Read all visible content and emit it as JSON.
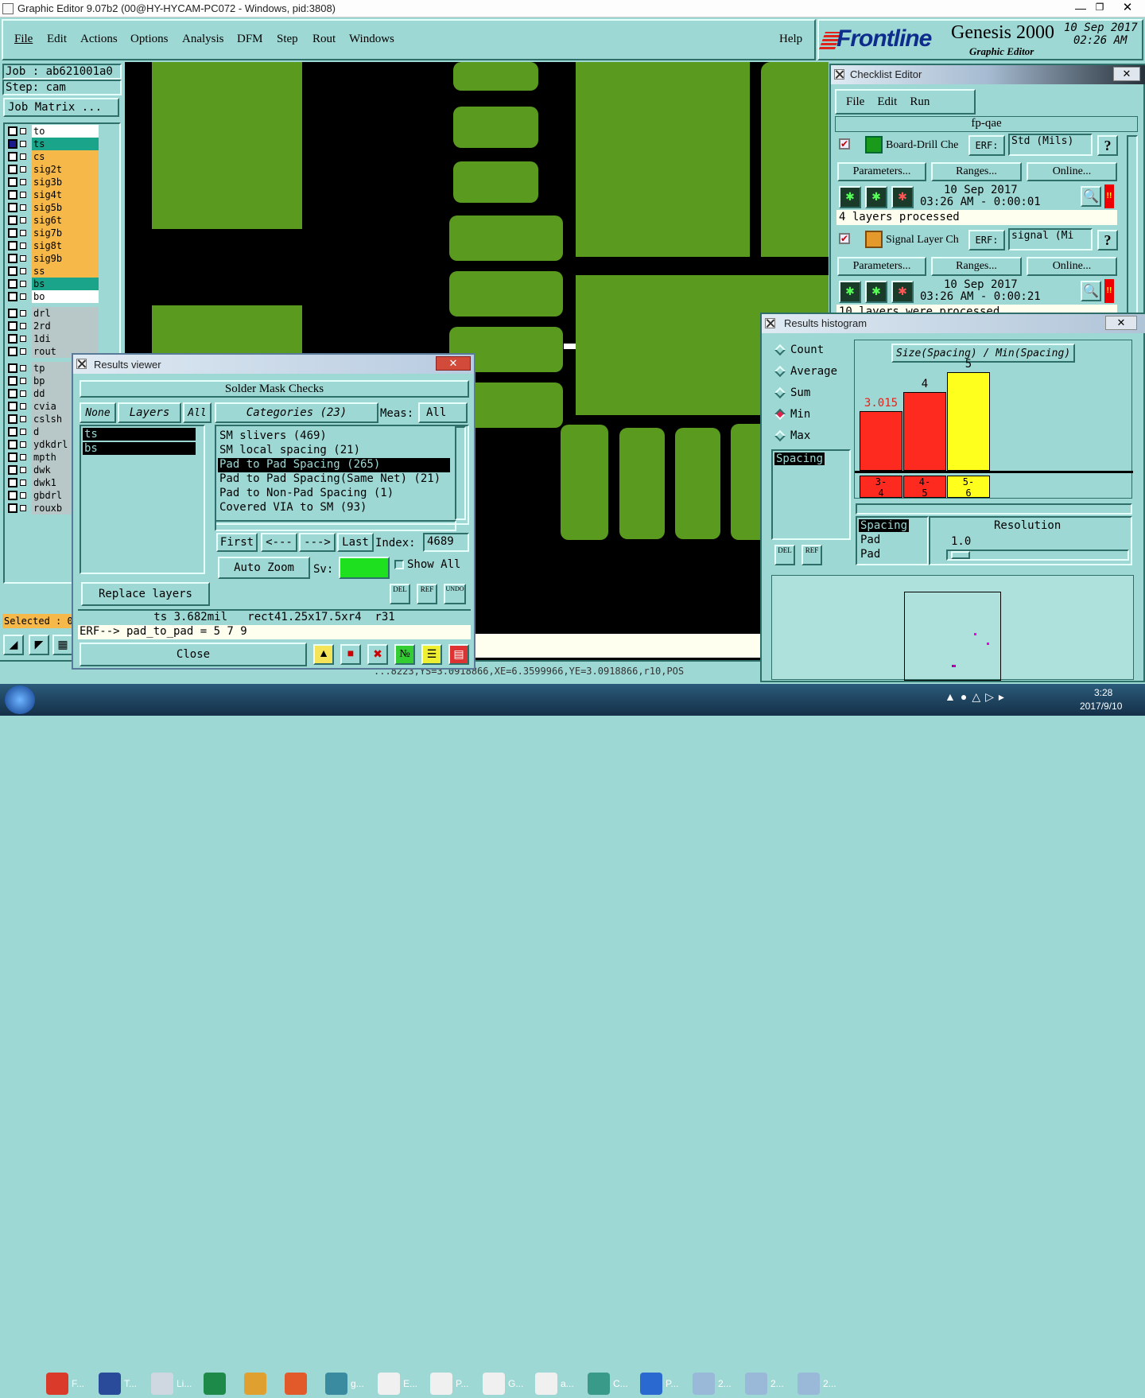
{
  "titlebar": {
    "title": "Graphic Editor 9.07b2 (00@HY-HYCAM-PC072 - Windows, pid:3808)"
  },
  "menu": {
    "items": [
      "File",
      "Edit",
      "Actions",
      "Options",
      "Analysis",
      "DFM",
      "Step",
      "Rout",
      "Windows"
    ],
    "help": "Help"
  },
  "brand": {
    "logo": "Frontline",
    "product": "Genesis 2000",
    "sub": "Graphic Editor",
    "date": "10 Sep 2017",
    "time": "02:26 AM"
  },
  "job": {
    "job": "Job : ab621001a0",
    "step": "Step: cam",
    "matrix": "Job Matrix ..."
  },
  "layers": [
    {
      "name": "to",
      "color": "#ffffff"
    },
    {
      "name": "ts",
      "color": "#1aa58a"
    },
    {
      "name": "cs",
      "color": "#f7b84a"
    },
    {
      "name": "sig2t",
      "color": "#f7b84a"
    },
    {
      "name": "sig3b",
      "color": "#f7b84a"
    },
    {
      "name": "sig4t",
      "color": "#f7b84a"
    },
    {
      "name": "sig5b",
      "color": "#f7b84a"
    },
    {
      "name": "sig6t",
      "color": "#f7b84a"
    },
    {
      "name": "sig7b",
      "color": "#f7b84a"
    },
    {
      "name": "sig8t",
      "color": "#f7b84a"
    },
    {
      "name": "sig9b",
      "color": "#f7b84a"
    },
    {
      "name": "ss",
      "color": "#f7b84a"
    },
    {
      "name": "bs",
      "color": "#1aa58a"
    },
    {
      "name": "bo",
      "color": "#ffffff"
    }
  ],
  "drill_layers": [
    "drl",
    "2rd",
    "1di",
    "rout"
  ],
  "other_layers": [
    "tp",
    "bp",
    "dd",
    "cvia",
    "cslsh",
    "d",
    "ydkdrl",
    "mpth",
    "dwk",
    "dwk1",
    "gbdrl",
    "rouxb"
  ],
  "selected_label": "Selected : 0",
  "coords_text": "...8223,YS=3.0918866,XE=6.3599966,YE=3.0918866,r10,POS",
  "checklist": {
    "title": "Checklist Editor",
    "menu": [
      "File",
      "Edit",
      "Run"
    ],
    "name": "fp-qae",
    "checks": [
      {
        "name": "Board-Drill Che",
        "erf": "ERF:",
        "erf_value": "Std (Mils)",
        "buttons": [
          "Parameters...",
          "Ranges...",
          "Online..."
        ],
        "date": "10 Sep 2017",
        "time": "03:26 AM - 0:00:01",
        "status": "4 layers processed"
      },
      {
        "name": "Signal Layer Ch",
        "erf": "ERF:",
        "erf_value": "signal (Mi",
        "buttons": [
          "Parameters...",
          "Ranges...",
          "Online..."
        ],
        "date": "10 Sep 2017",
        "time": "03:26 AM - 0:00:21",
        "status": "10 layers were processed"
      }
    ]
  },
  "results": {
    "title": "Results viewer",
    "header": "Solder Mask Checks",
    "none": "None",
    "layers": "Layers",
    "all": "All",
    "layer_list": [
      "ts",
      "bs"
    ],
    "categories": "Categories (23)",
    "meas_label": "Meas:",
    "meas_value": "All",
    "category_list": [
      "SM slivers (469)",
      "SM local spacing (21)",
      "Pad to Pad Spacing (265)",
      "Pad to Pad Spacing(Same Net) (21)",
      "Pad to Non-Pad Spacing (1)",
      "Covered VIA to SM (93)"
    ],
    "selected_category": 2,
    "nav": [
      "First",
      "<---",
      "--->",
      "Last"
    ],
    "index_label": "Index:",
    "index_value": "4689",
    "auto_zoom": "Auto Zoom",
    "sv": "Sv:",
    "show_all": "Show All",
    "replace_layers": "Replace layers",
    "icons": [
      "DEL",
      "REF",
      "UNDO"
    ],
    "info": "ts 3.682mil   rect41.25x17.5xr4  r31",
    "erf": "ERF--> pad_to_pad = 5 7 9",
    "close": "Close"
  },
  "histogram": {
    "title": "Results histogram",
    "modes": [
      "Count",
      "Average",
      "Sum",
      "Min",
      "Max"
    ],
    "selected_mode": "Min",
    "list": [
      "Spacing"
    ],
    "chart_title": "Size(Spacing) / Min(Spacing)",
    "bars": [
      {
        "label": "3.015",
        "range": "3-4",
        "color": "#ff2a1f"
      },
      {
        "label": "4",
        "range": "4-5",
        "color": "#ff2a1f"
      },
      {
        "label": "5",
        "range": "5-6",
        "color": "#ffff1e"
      }
    ],
    "list2": [
      "Spacing",
      "Pad",
      "Pad"
    ],
    "resolution_label": "Resolution",
    "resolution_value": "1.0",
    "icons": [
      "DEL",
      "REF"
    ]
  },
  "taskbar": {
    "items": [
      "F...",
      "T...",
      "Li...",
      "",
      "",
      "",
      "g...",
      "E...",
      "P...",
      "G...",
      "a...",
      "C...",
      "P...",
      "2...",
      "2...",
      "2..."
    ],
    "time": "3:28",
    "date": "2017/9/10"
  }
}
